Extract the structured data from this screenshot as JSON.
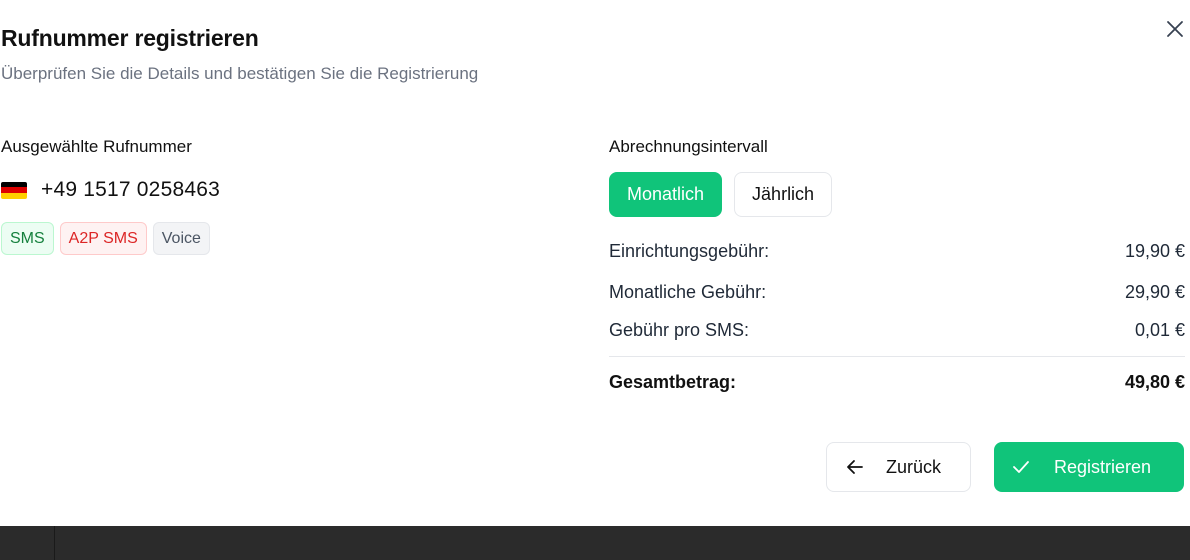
{
  "dialog": {
    "title": "Rufnummer registrieren",
    "subtitle": "Überprüfen Sie die Details und bestätigen Sie die Registrierung",
    "close_icon": "close-icon"
  },
  "selected_number": {
    "label": "Ausgewählte Rufnummer",
    "flag_icon": "germany-flag-icon",
    "phone": "+49 1517 0258463",
    "badges": [
      {
        "label": "SMS",
        "color": "#15803d"
      },
      {
        "label": "A2P SMS",
        "color": "#dc2626"
      },
      {
        "label": "Voice",
        "color": "#4b5563"
      }
    ]
  },
  "billing": {
    "label": "Abrechnungsintervall",
    "options": [
      {
        "label": "Monatlich",
        "selected": true
      },
      {
        "label": "Jährlich",
        "selected": false
      }
    ],
    "fees": [
      {
        "label": "Einrichtungsgebühr:",
        "value": "19,90 €"
      },
      {
        "label": "Monatliche Gebühr:",
        "value": "29,90 €"
      },
      {
        "label": "Gebühr pro SMS:",
        "value": "0,01 €"
      }
    ],
    "total": {
      "label": "Gesamtbetrag:",
      "value": "49,80 €"
    }
  },
  "actions": {
    "back_label": "Zurück",
    "back_icon": "arrow-left-icon",
    "register_label": "Registrieren",
    "register_icon": "check-icon"
  },
  "colors": {
    "accent": "#10c47a",
    "bottom_bar": "#2b2b2b"
  }
}
